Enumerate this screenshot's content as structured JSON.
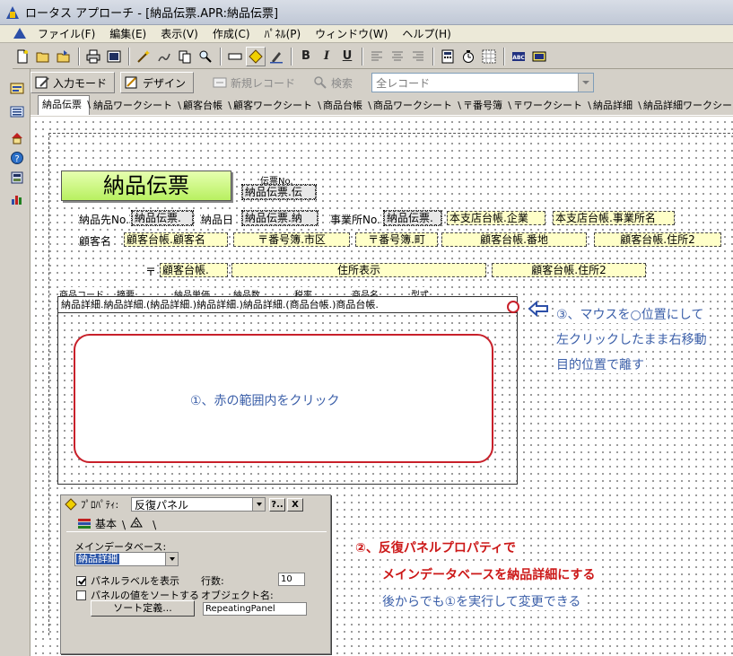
{
  "window": {
    "title": "ロータス アプローチ - [納品伝票.APR:納品伝票]"
  },
  "menu": [
    "ファイル(F)",
    "編集(E)",
    "表示(V)",
    "作成(C)",
    "ﾊﾟﾈﾙ(P)",
    "ウィンドウ(W)",
    "ヘルプ(H)"
  ],
  "toolbar": {
    "icons": [
      "new-file-icon",
      "open-folder-icon",
      "open-file-icon",
      "print-icon",
      "preview-icon",
      "wand-icon",
      "pen-icon",
      "copy-icon",
      "zoom-icon",
      "field-icon",
      "diamond-icon",
      "brush-icon",
      "bold-icon",
      "italic-icon",
      "underline-icon",
      "align-left-icon",
      "align-center-icon",
      "align-right-icon",
      "calc-icon",
      "timer-icon",
      "grid-icon",
      "abc-icon",
      "image-icon"
    ],
    "bold": "B",
    "italic": "I",
    "underline": "U"
  },
  "modebar": {
    "input_mode": "入力モード",
    "design": "デザイン",
    "new_record": "新規レコード",
    "search": "検索",
    "record_select": "全レコード"
  },
  "tabs": [
    "納品伝票",
    "納品ワークシート",
    "顧客台帳",
    "顧客ワークシート",
    "商品台帳",
    "商品ワークシート",
    "〒番号簿",
    "〒ワークシート",
    "納品詳細",
    "納品詳細ワークシート"
  ],
  "form": {
    "title": "納品伝票",
    "slip_no_label": "伝票No.",
    "slip_no_field": "納品伝票.伝",
    "customer_no_label": "納品先No.",
    "customer_no_field": "納品伝票.",
    "date_label": "納品日",
    "date_field": "納品伝票.納",
    "office_no_label": "事業所No.",
    "office_no_field": "納品伝票.",
    "company_field": "本支店台帳.企業",
    "office_name_field": "本支店台帳.事業所名",
    "customer_name_label": "顧客名",
    "customer_name_field": "顧客台帳.顧客名",
    "city_field": "〒番号簿.市区",
    "town_field": "〒番号簿.町",
    "address_no_field": "顧客台帳.番地",
    "address2_field": "顧客台帳.住所2",
    "zip_label": "〒",
    "zip_field": "顧客台帳.",
    "address_display_field": "住所表示",
    "address2b_field": "顧客台帳.住所2",
    "columns": [
      "商品コード",
      "摘要",
      "納品単価",
      "納品数",
      "税率",
      "商品名",
      "型式"
    ],
    "repeat_row": "納品詳細.納品詳細.(納品詳細.)納品詳細.)納品詳細.(商品台帳.)商品台帳.",
    "red_area_label": "①、赤の範囲内をクリック"
  },
  "notes": {
    "step3_line1": "③、マウスを○位置にして",
    "step3_line2": "左クリックしたまま右移動",
    "step3_line3": "目的位置で離す",
    "step2_line1": "②、反復パネルプロパティで",
    "step2_line2": "メインデータベースを納品詳細にする",
    "step2_line3": "後からでも①を実行して変更できる"
  },
  "properties": {
    "header_label": "ﾌﾟﾛﾊﾟﾃｨ:",
    "object_type": "反復パネル",
    "help_btn": "?..",
    "close_btn": "X",
    "tab_basic": "基本",
    "tab_style": "",
    "main_db_label": "メインデータベース:",
    "main_db_value": "納品詳細",
    "show_border_label": "パネルラベルを表示",
    "show_border_checked": true,
    "sort_label": "パネルの値をソートする",
    "sort_checked": false,
    "sort_define_btn": "ソート定義...",
    "rows_label": "行数:",
    "rows_value": "10",
    "object_name_label": "オブジェクト名:",
    "object_name_value": "RepeatingPanel"
  }
}
